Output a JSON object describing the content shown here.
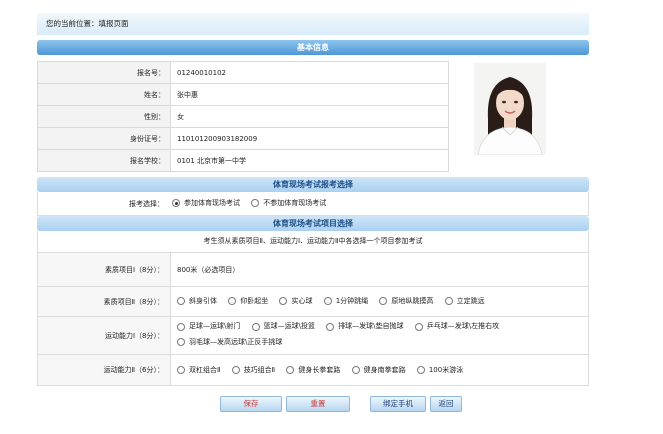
{
  "breadcrumb": {
    "text": "您的当前位置：填报页面"
  },
  "basic": {
    "title": "基本信息",
    "rows": [
      {
        "label": "报名号：",
        "value": "01240010102"
      },
      {
        "label": "姓名：",
        "value": "张中惠"
      },
      {
        "label": "性别：",
        "value": "女"
      },
      {
        "label": "身份证号：",
        "value": "110101200903182009"
      },
      {
        "label": "报名学校：",
        "value": "0101  北京市第一中学"
      }
    ]
  },
  "exam_choice": {
    "title": "体育现场考试报考选择",
    "label": "报考选择：",
    "options": [
      "参加体育现场考试",
      "不参加体育现场考试"
    ],
    "selected": "参加体育现场考试"
  },
  "items": {
    "title": "体育现场考试项目选择",
    "notice": "考生须从素质项目Ⅱ、运动能力Ⅰ、运动能力Ⅱ中各选择一个项目参加考试",
    "rows": [
      {
        "label": "素质项目Ⅰ（8分）：",
        "text": "800米（必选项目）"
      },
      {
        "label": "素质项目Ⅱ（8分）：",
        "options": [
          "斜身引体",
          "仰卧起坐",
          "实心球",
          "1分钟跳绳",
          "原地纵跳摸高",
          "立定跳远"
        ]
      },
      {
        "label": "运动能力Ⅰ（8分）：",
        "options": [
          "足球—运球\\射门",
          "篮球—运球\\投篮",
          "排球—发球\\垫自抛球",
          "乒乓球—发球\\左推右攻",
          "羽毛球—发高远球\\正反手挑球"
        ]
      },
      {
        "label": "运动能力Ⅱ（6分）：",
        "options": [
          "双杠组合Ⅱ",
          "技巧组合Ⅱ",
          "健身长拳套路",
          "健身南拳套路",
          "100米游泳"
        ]
      }
    ]
  },
  "buttons": {
    "save": "保存",
    "reset": "重置",
    "bind_phone": "绑定手机",
    "back": "返回"
  }
}
